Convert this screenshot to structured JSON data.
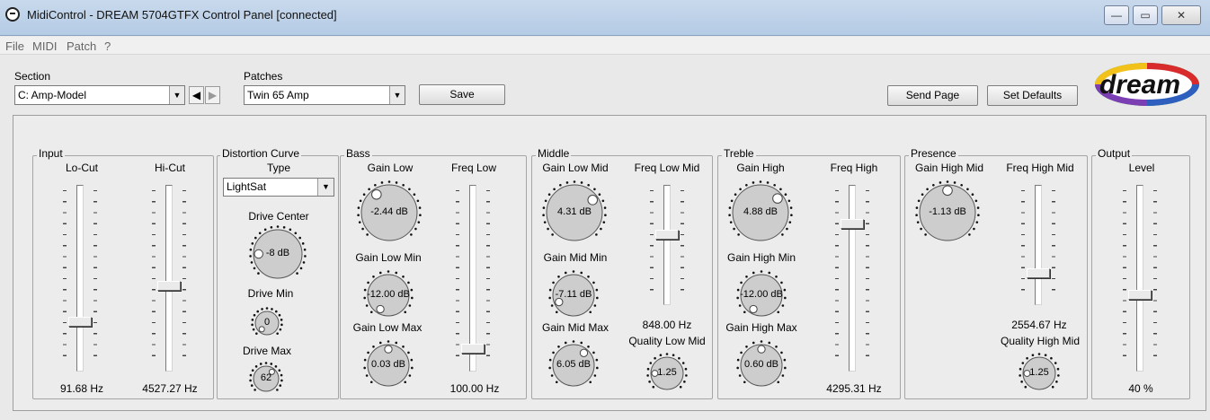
{
  "window": {
    "title": "MidiControl - DREAM 5704GTFX Control Panel [connected]",
    "buttons": [
      "—",
      "▭",
      "✕"
    ]
  },
  "menu": [
    "File",
    "MIDI",
    "Patch",
    "?"
  ],
  "toolbar": {
    "section_label": "Section",
    "section_value": "C: Amp-Model",
    "prev_glyph": "◀",
    "next_glyph": "▶",
    "patches_label": "Patches",
    "patches_value": "Twin 65 Amp",
    "save_label": "Save",
    "send_page_label": "Send Page",
    "set_defaults_label": "Set Defaults",
    "logo_text": "dream"
  },
  "groups": {
    "input": {
      "title": "Input",
      "locut_label": "Lo-Cut",
      "locut_value": "91.68 Hz",
      "locut_level": 0.24,
      "hicut_label": "Hi-Cut",
      "hicut_value": "4527.27 Hz",
      "hicut_level": 0.45
    },
    "distortion": {
      "title": "Distortion Curve",
      "type_label": "Type",
      "type_value": "LightSat",
      "drive_center_label": "Drive Center",
      "drive_center_value": "-8 dB",
      "drive_min_label": "Drive Min",
      "drive_min_value": "0",
      "drive_max_label": "Drive Max",
      "drive_max_value": "62"
    },
    "bass": {
      "title": "Bass",
      "gain_low_label": "Gain Low",
      "gain_low_value": "-2.44 dB",
      "gain_low_min_label": "Gain Low Min",
      "gain_low_min_value": "-12.00 dB",
      "gain_low_max_label": "Gain Low Max",
      "gain_low_max_value": "0.03 dB",
      "freq_low_label": "Freq Low",
      "freq_low_value": "100.00 Hz",
      "freq_low_level": 0.08
    },
    "middle": {
      "title": "Middle",
      "gain_low_mid_label": "Gain Low Mid",
      "gain_low_mid_value": "4.31 dB",
      "gain_mid_min_label": "Gain Mid Min",
      "gain_mid_min_value": "-7.11 dB",
      "gain_mid_max_label": "Gain Mid Max",
      "gain_mid_max_value": "6.05 dB",
      "freq_low_mid_label": "Freq Low Mid",
      "freq_low_mid_value": "848.00 Hz",
      "freq_low_mid_level": 0.6,
      "quality_low_mid_label": "Quality Low Mid",
      "quality_low_mid_value": "1.25"
    },
    "treble": {
      "title": "Treble",
      "gain_high_label": "Gain High",
      "gain_high_value": "4.88 dB",
      "gain_high_min_label": "Gain High Min",
      "gain_high_min_value": "-12.00 dB",
      "gain_high_max_label": "Gain High Max",
      "gain_high_max_value": "0.60 dB",
      "freq_high_label": "Freq High",
      "freq_high_value": "4295.31 Hz",
      "freq_high_level": 0.82
    },
    "presence": {
      "title": "Presence",
      "gain_high_mid_label": "Gain High Mid",
      "gain_high_mid_value": "-1.13 dB",
      "freq_high_mid_label": "Freq High Mid",
      "freq_high_mid_value": "2554.67 Hz",
      "freq_high_mid_level": 0.22,
      "quality_high_mid_label": "Quality High Mid",
      "quality_high_mid_value": "1.25"
    },
    "output": {
      "title": "Output",
      "level_label": "Level",
      "level_value": "40 %",
      "level_fraction": 0.4
    }
  },
  "colors": {
    "titlebar": "#c9d9ec",
    "panel": "#ececec",
    "knob": "#cdcdcd"
  }
}
